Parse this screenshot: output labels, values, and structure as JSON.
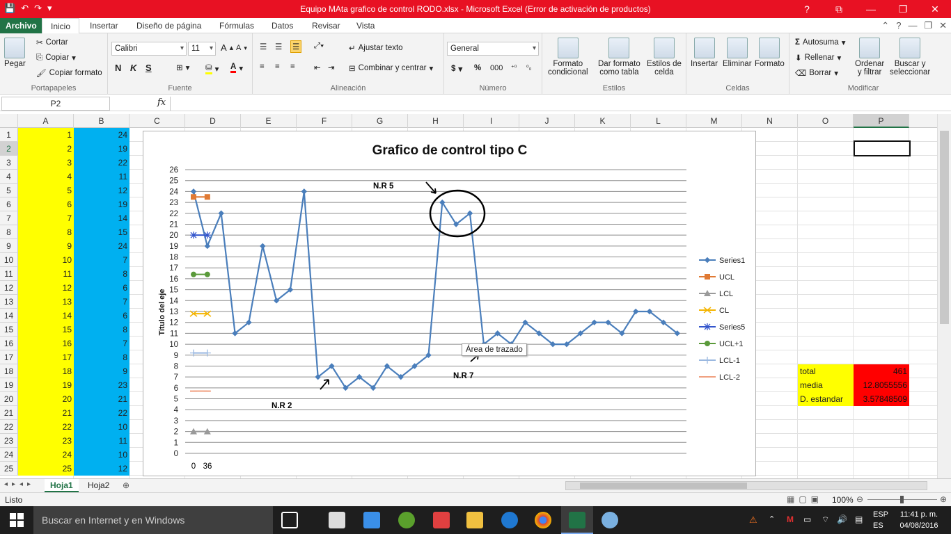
{
  "window": {
    "title": "Equipo MAta grafico de control RODO.xlsx - Microsoft Excel (Error de activación de productos)"
  },
  "tabs": {
    "file": "Archivo",
    "items": [
      "Inicio",
      "Insertar",
      "Diseño de página",
      "Fórmulas",
      "Datos",
      "Revisar",
      "Vista"
    ]
  },
  "ribbon": {
    "clipboard": {
      "paste": "Pegar",
      "cut": "Cortar",
      "copy": "Copiar",
      "format_painter": "Copiar formato",
      "label": "Portapapeles"
    },
    "font": {
      "name": "Calibri",
      "size": "11",
      "bold": "N",
      "italic": "K",
      "underline": "S",
      "label": "Fuente"
    },
    "alignment": {
      "wrap": "Ajustar texto",
      "merge": "Combinar y centrar",
      "label": "Alineación"
    },
    "number": {
      "format": "General",
      "currency": "$",
      "percent": "%",
      "thousands": "000",
      "label": "Número"
    },
    "styles": {
      "conditional_1": "Formato",
      "conditional_2": "condicional",
      "table_1": "Dar formato",
      "table_2": "como tabla",
      "cell_1": "Estilos de",
      "cell_2": "celda",
      "label": "Estilos"
    },
    "cells": {
      "insert": "Insertar",
      "delete": "Eliminar",
      "format": "Formato",
      "label": "Celdas"
    },
    "editing": {
      "autosum": "Autosuma",
      "fill": "Rellenar",
      "clear": "Borrar",
      "sort_1": "Ordenar",
      "sort_2": "y filtrar",
      "find_1": "Buscar y",
      "find_2": "seleccionar",
      "label": "Modificar"
    }
  },
  "formula_bar": {
    "name_box": "P2",
    "fx": "fx",
    "content": ""
  },
  "columns": [
    "A",
    "B",
    "C",
    "D",
    "E",
    "F",
    "G",
    "H",
    "I",
    "J",
    "K",
    "L",
    "M",
    "N",
    "O",
    "P"
  ],
  "rows": [
    1,
    2,
    3,
    4,
    5,
    6,
    7,
    8,
    9,
    10,
    11,
    12,
    13,
    14,
    15,
    16,
    17,
    18,
    19,
    20,
    21,
    22,
    23,
    24,
    25
  ],
  "col_a": [
    1,
    2,
    3,
    4,
    5,
    6,
    7,
    8,
    9,
    10,
    11,
    12,
    13,
    14,
    15,
    16,
    17,
    18,
    19,
    20,
    21,
    22,
    23,
    24,
    25
  ],
  "col_b": [
    24,
    19,
    22,
    11,
    12,
    19,
    14,
    15,
    24,
    7,
    8,
    6,
    7,
    6,
    8,
    7,
    8,
    9,
    23,
    21,
    22,
    10,
    11,
    10,
    12
  ],
  "stats": {
    "total_label": "total",
    "total_value": "461",
    "mean_label": "media",
    "mean_value": "12.8055556",
    "sd_label": "D. estandar",
    "sd_value": "3.57848509"
  },
  "chart_data": {
    "type": "line",
    "title": "Grafico de control tipo C",
    "ylabel": "Titulo del eje",
    "ylim": [
      0,
      26
    ],
    "yticks": [
      0,
      1,
      2,
      3,
      4,
      5,
      6,
      7,
      8,
      9,
      10,
      11,
      12,
      13,
      14,
      15,
      16,
      17,
      18,
      19,
      20,
      21,
      22,
      23,
      24,
      25,
      26
    ],
    "xtick_labels": [
      "0",
      "36"
    ],
    "grid": true,
    "legend_position": "right",
    "series": [
      {
        "name": "Series1",
        "color": "#4a7ebb",
        "values": [
          24,
          19,
          22,
          11,
          12,
          19,
          14,
          15,
          24,
          7,
          8,
          6,
          7,
          6,
          8,
          7,
          8,
          9,
          23,
          21,
          22,
          10,
          11,
          10,
          12,
          11,
          10,
          10,
          11,
          12,
          12,
          11,
          13,
          13,
          12,
          11
        ]
      },
      {
        "name": "UCL",
        "color": "#e07a34",
        "values": [
          23.5,
          23.5
        ]
      },
      {
        "name": "LCL",
        "color": "#9a9a9a",
        "values": [
          2,
          2
        ]
      },
      {
        "name": "CL",
        "color": "#f4b400",
        "values": [
          12.8,
          12.8
        ]
      },
      {
        "name": "Series5",
        "color": "#3355cc",
        "values": [
          20,
          20
        ]
      },
      {
        "name": "UCL+1",
        "color": "#5a9a3a",
        "values": [
          16.4,
          16.4
        ]
      },
      {
        "name": "LCL-1",
        "color": "#9ab8e0",
        "values": [
          9.2,
          9.2
        ]
      },
      {
        "name": "LCL-2",
        "color": "#f0a080",
        "values": [
          5.7,
          5.7
        ]
      }
    ],
    "annotations": [
      "N.R 5",
      "N.R 2",
      "N.R 7"
    ],
    "tooltip": "Área de trazado"
  },
  "sheets": [
    "Hoja1",
    "Hoja2"
  ],
  "status": {
    "ready": "Listo",
    "zoom": "100%"
  },
  "taskbar": {
    "search": "Buscar en Internet y en Windows",
    "lang1": "ESP",
    "lang2": "ES",
    "time": "11:41 p. m.",
    "date": "04/08/2016"
  }
}
